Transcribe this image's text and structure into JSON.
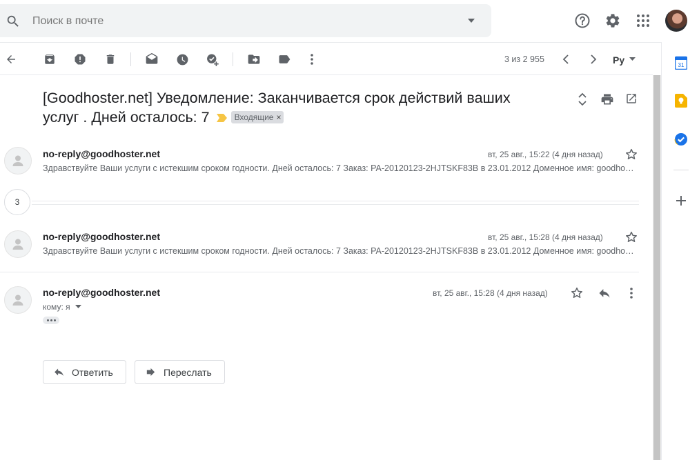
{
  "search": {
    "placeholder": "Поиск в почте"
  },
  "toolbar": {
    "pager": "3 из 2 955",
    "language": "Ру"
  },
  "email": {
    "subject": "[Goodhoster.net] Уведомление: Заканчивается срок действий ваших услуг . Дней осталось: 7",
    "label": "Входящие",
    "label_close": "×",
    "collapsed_count": "3",
    "messages": [
      {
        "sender": "no-reply@goodhoster.net",
        "date": "вт, 25 авг., 15:22 (4 дня назад)",
        "snippet": "Здравствуйте Ваши услуги с истекшим сроком годности. Дней осталось: 7 Заказ: PA-20120123-2HJTSKF83B в 23.01.2012 Доменное имя: goodhoster.net"
      },
      {
        "sender": "no-reply@goodhoster.net",
        "date": "вт, 25 авг., 15:28 (4 дня назад)",
        "snippet": "Здравствуйте Ваши услуги с истекшим сроком годности. Дней осталось: 7 Заказ: PA-20120123-2HJTSKF83B в 23.01.2012 Доменное имя: goodhoster.net"
      },
      {
        "sender": "no-reply@goodhoster.net",
        "date": "вт, 25 авг., 15:28 (4 дня назад)",
        "to": "кому: я"
      }
    ]
  },
  "actions": {
    "reply": "Ответить",
    "forward": "Переслать"
  },
  "colors": {
    "label_arrow": "#f6c544",
    "keep": "#f6b400",
    "calendar": "#1a73e8",
    "tasks": "#1a73e8"
  }
}
